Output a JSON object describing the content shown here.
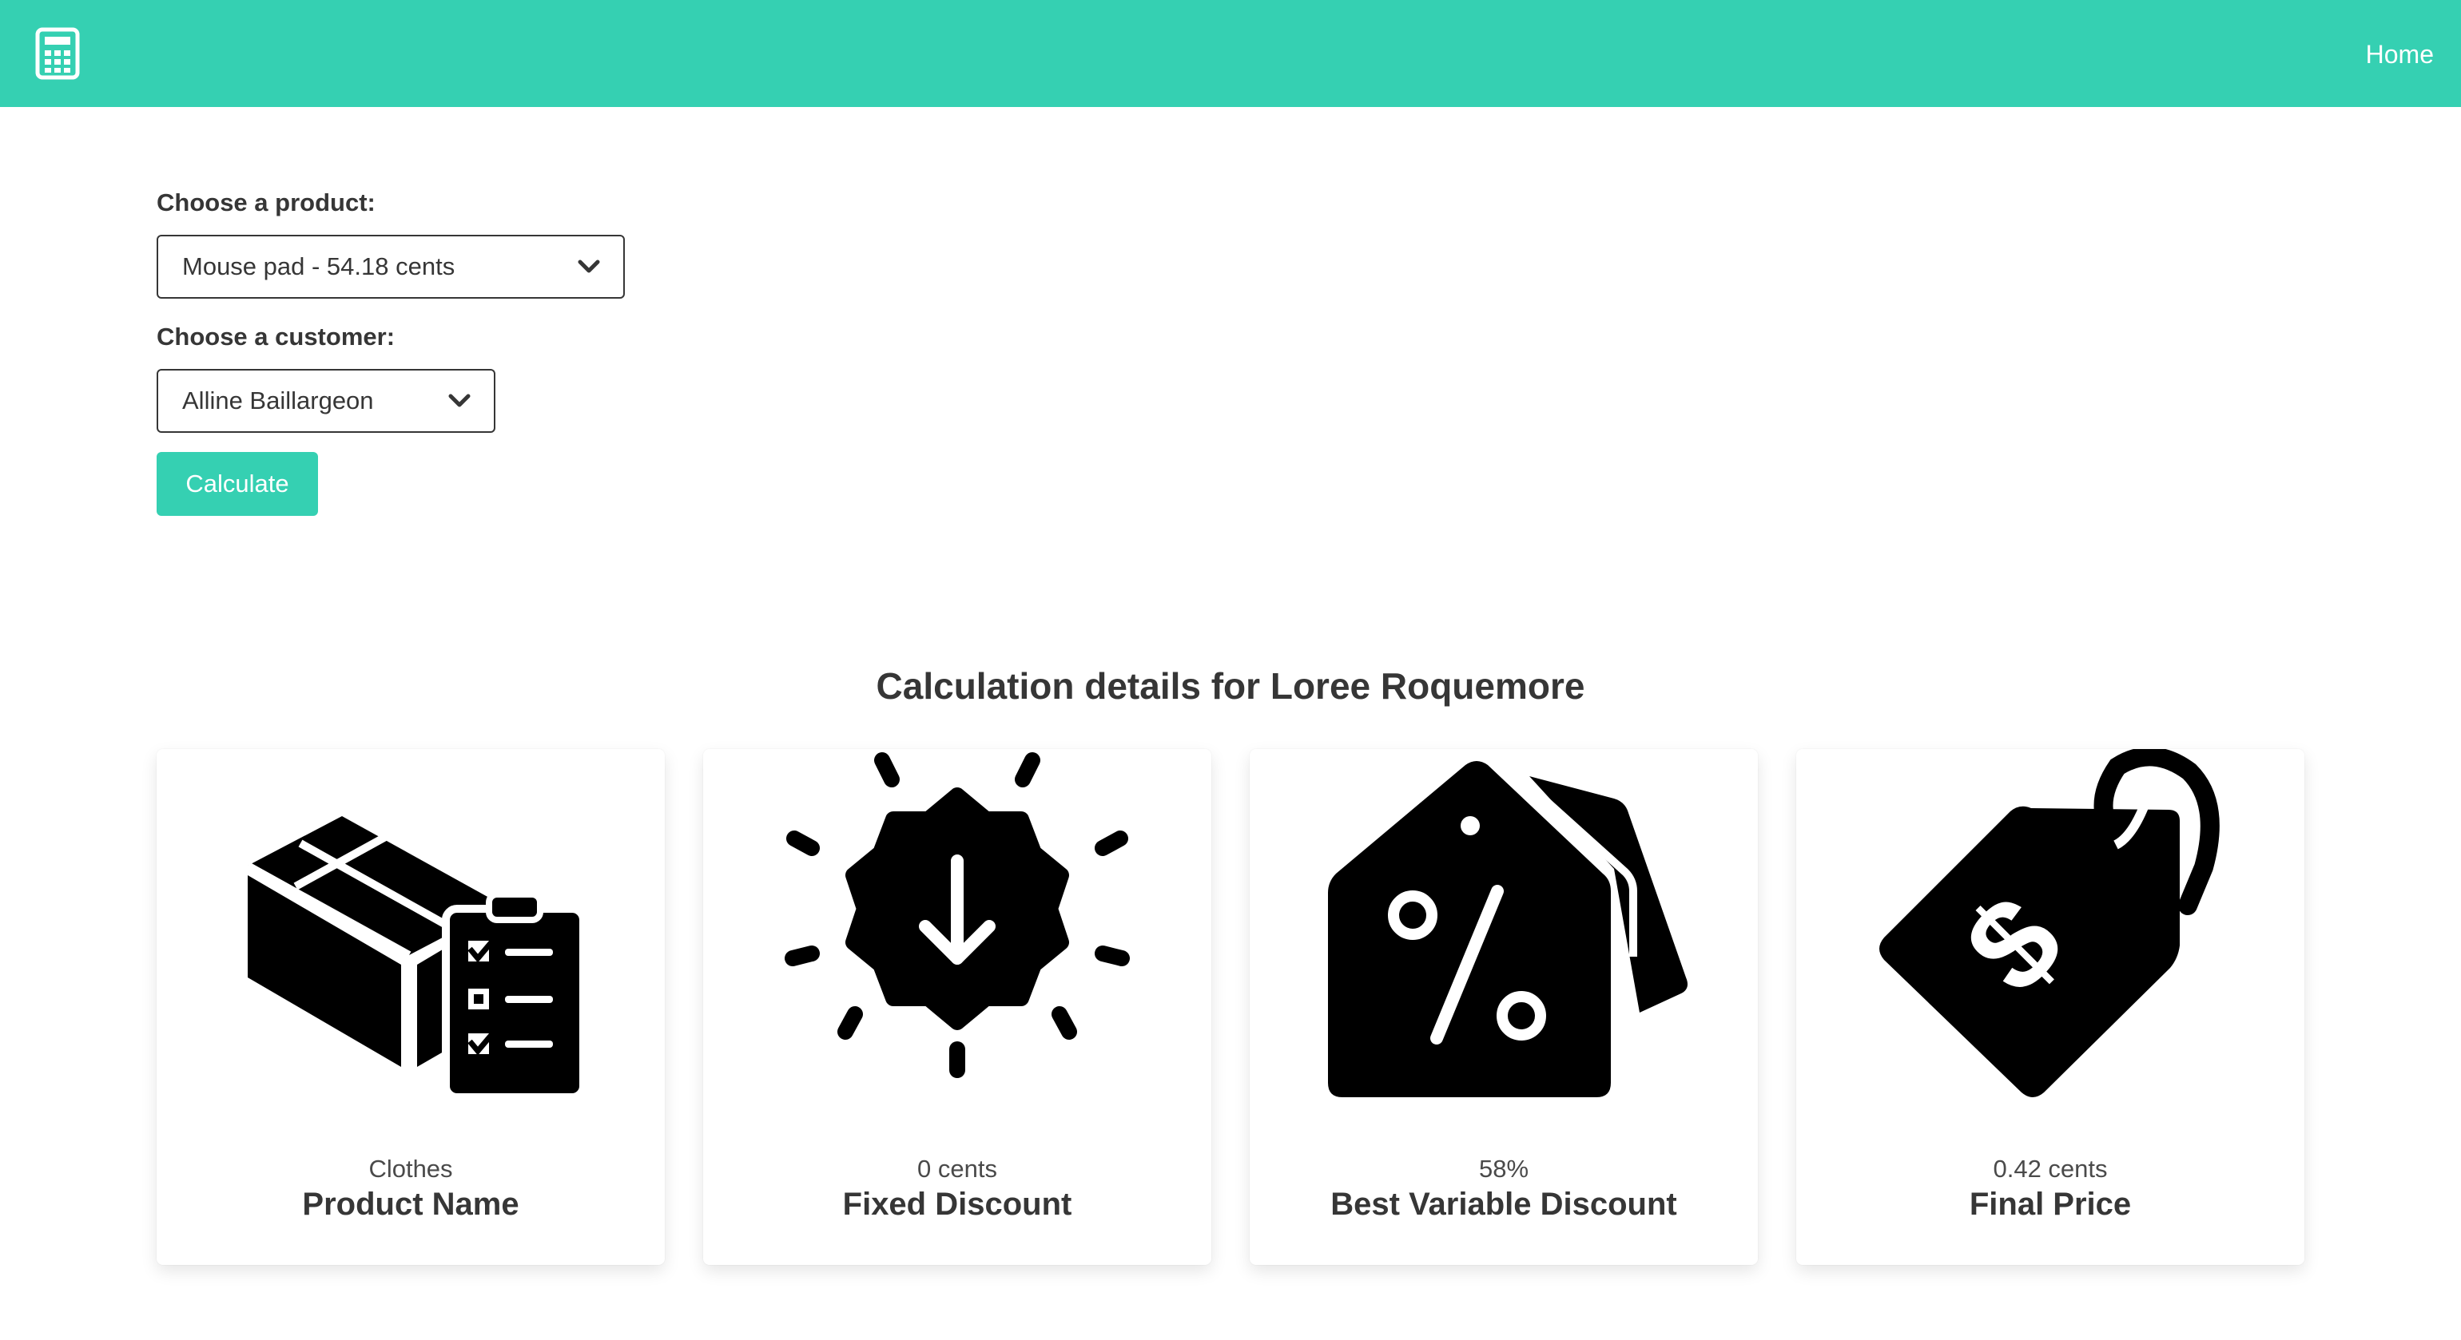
{
  "navbar": {
    "logo_icon": "calculator-icon",
    "home_label": "Home",
    "color": "#35d0b2"
  },
  "form": {
    "product_label": "Choose a product:",
    "product_value": "Mouse pad - 54.18 cents",
    "customer_label": "Choose a customer:",
    "customer_value": "Alline Baillargeon",
    "calculate_label": "Calculate"
  },
  "results": {
    "title": "Calculation details for Loree Roquemore",
    "cards": [
      {
        "icon": "product-box-checklist-icon",
        "value": "Clothes",
        "caption": "Product Name"
      },
      {
        "icon": "discount-badge-arrow-icon",
        "value": "0 cents",
        "caption": "Fixed Discount"
      },
      {
        "icon": "percent-tag-icon",
        "value": "58%",
        "caption": "Best Variable Discount"
      },
      {
        "icon": "dollar-tag-icon",
        "value": "0.42 cents",
        "caption": "Final Price"
      }
    ]
  }
}
